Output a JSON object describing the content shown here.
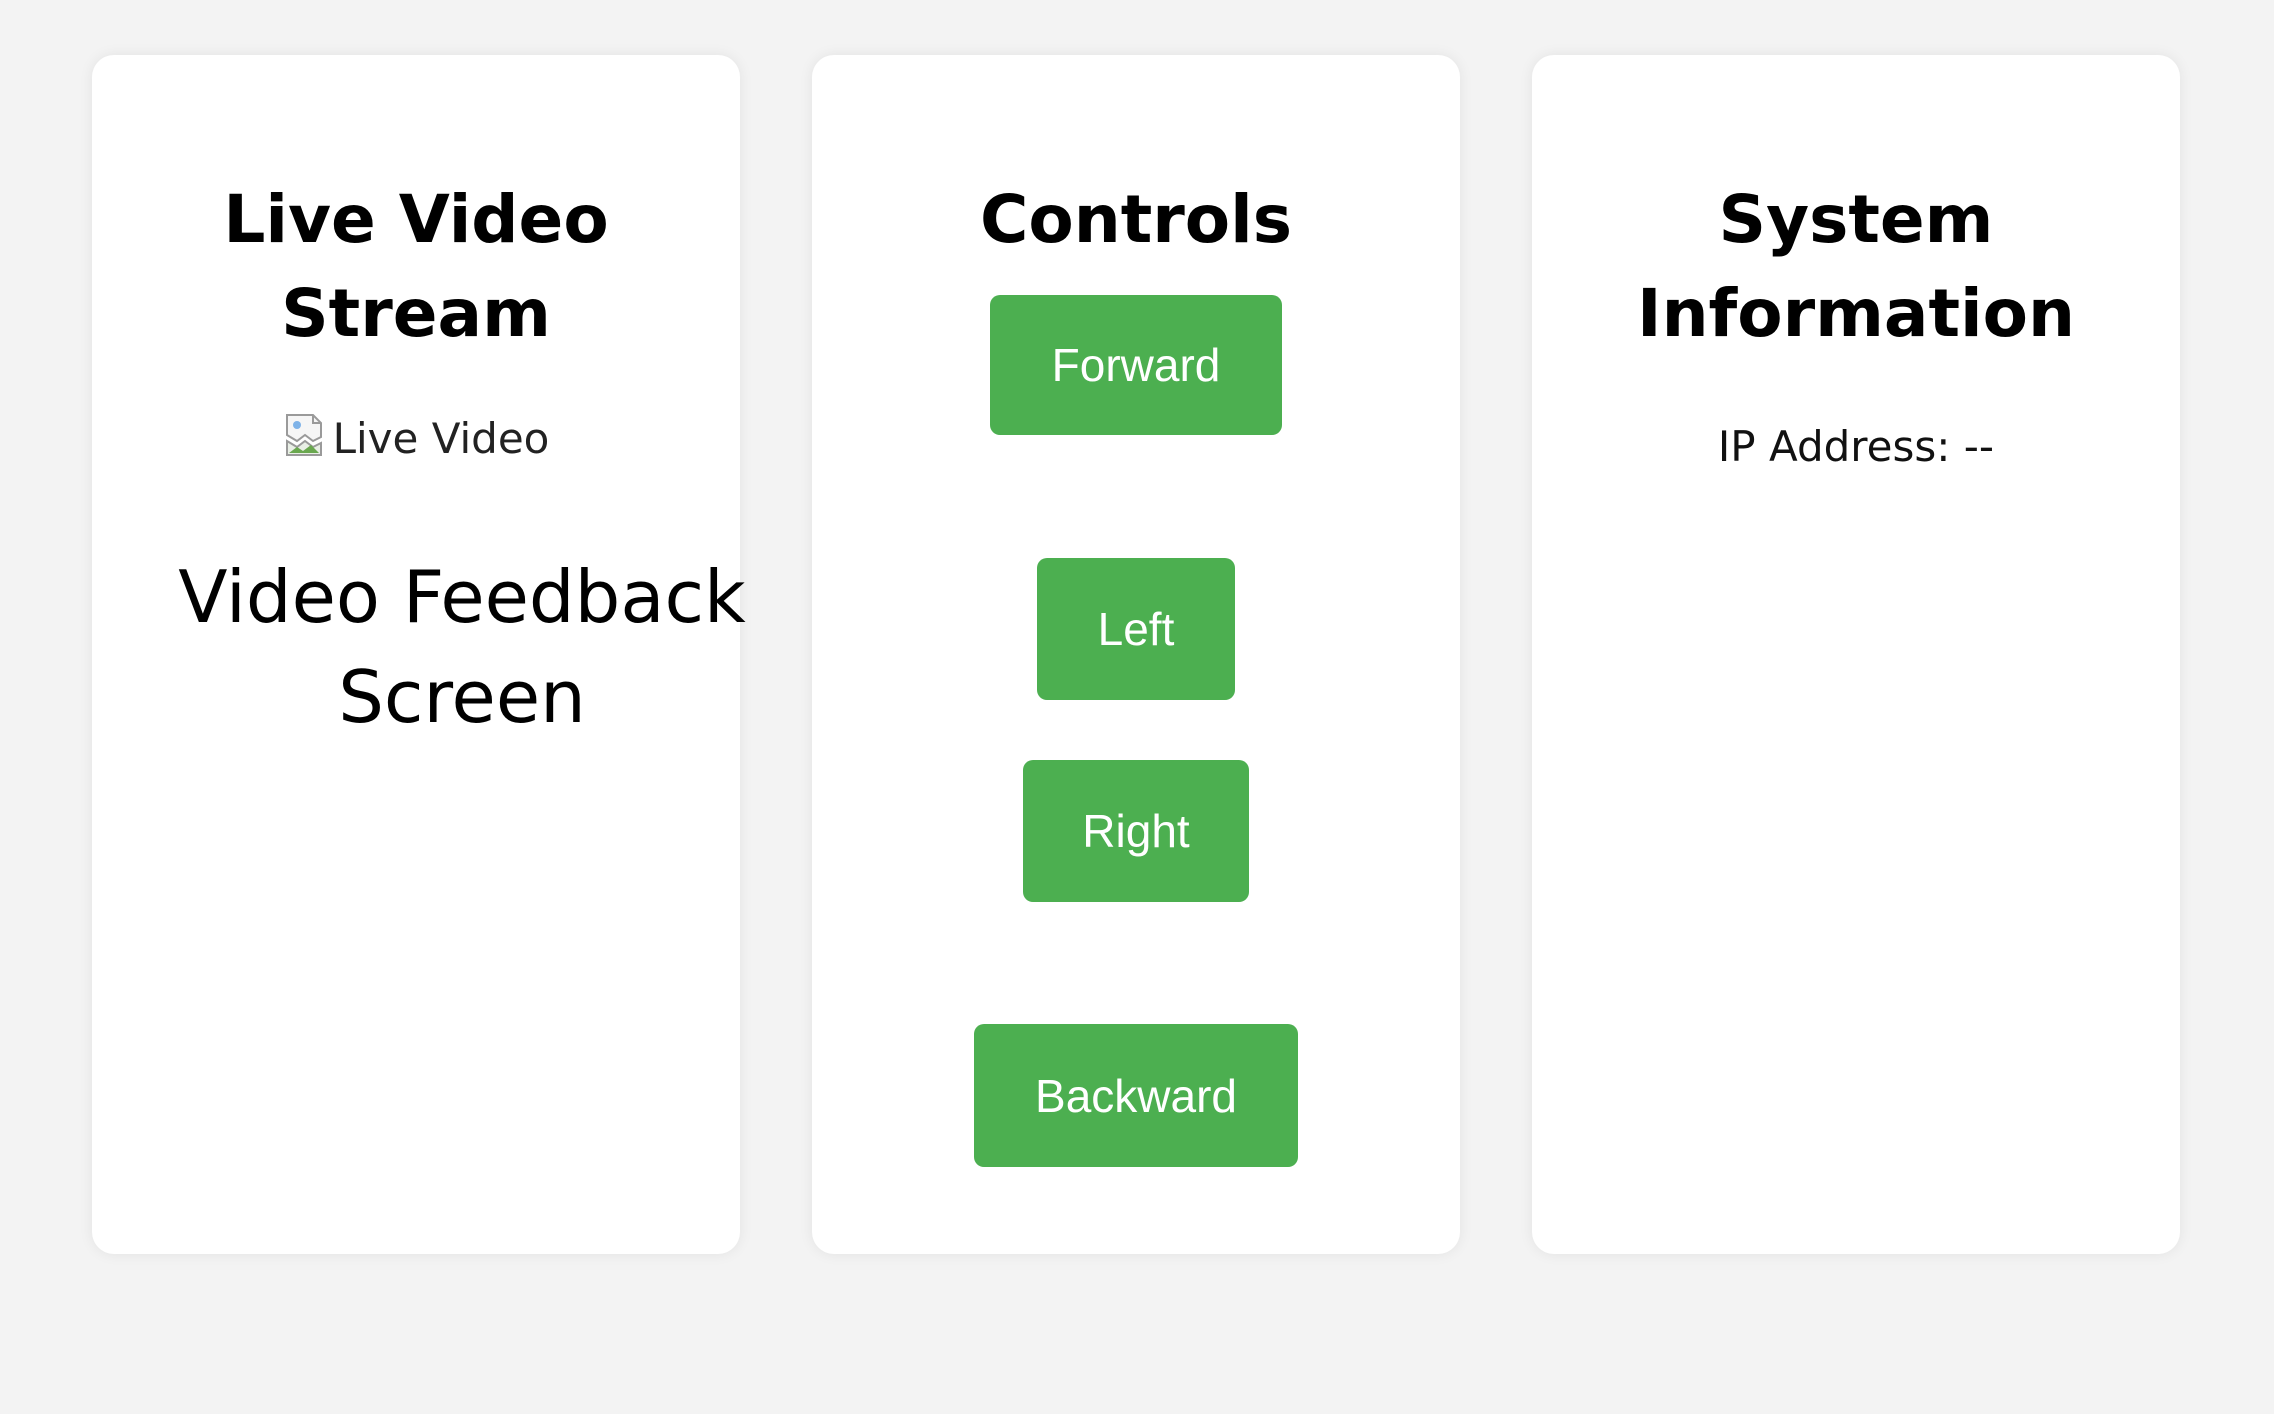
{
  "video_panel": {
    "title": "Live Video Stream",
    "image_alt": "Live Video",
    "image_icon": "broken-image-icon",
    "feedback_text": "Video Feedback Screen"
  },
  "controls_panel": {
    "title": "Controls",
    "buttons": {
      "forward": "Forward",
      "left": "Left",
      "right": "Right",
      "backward": "Backward"
    },
    "button_color": "#4caf50"
  },
  "system_panel": {
    "title": "System Information",
    "ip_label": "IP Address:",
    "ip_value": "--"
  },
  "colors": {
    "background": "#f3f3f3",
    "card": "#ffffff",
    "accent": "#4caf50"
  }
}
